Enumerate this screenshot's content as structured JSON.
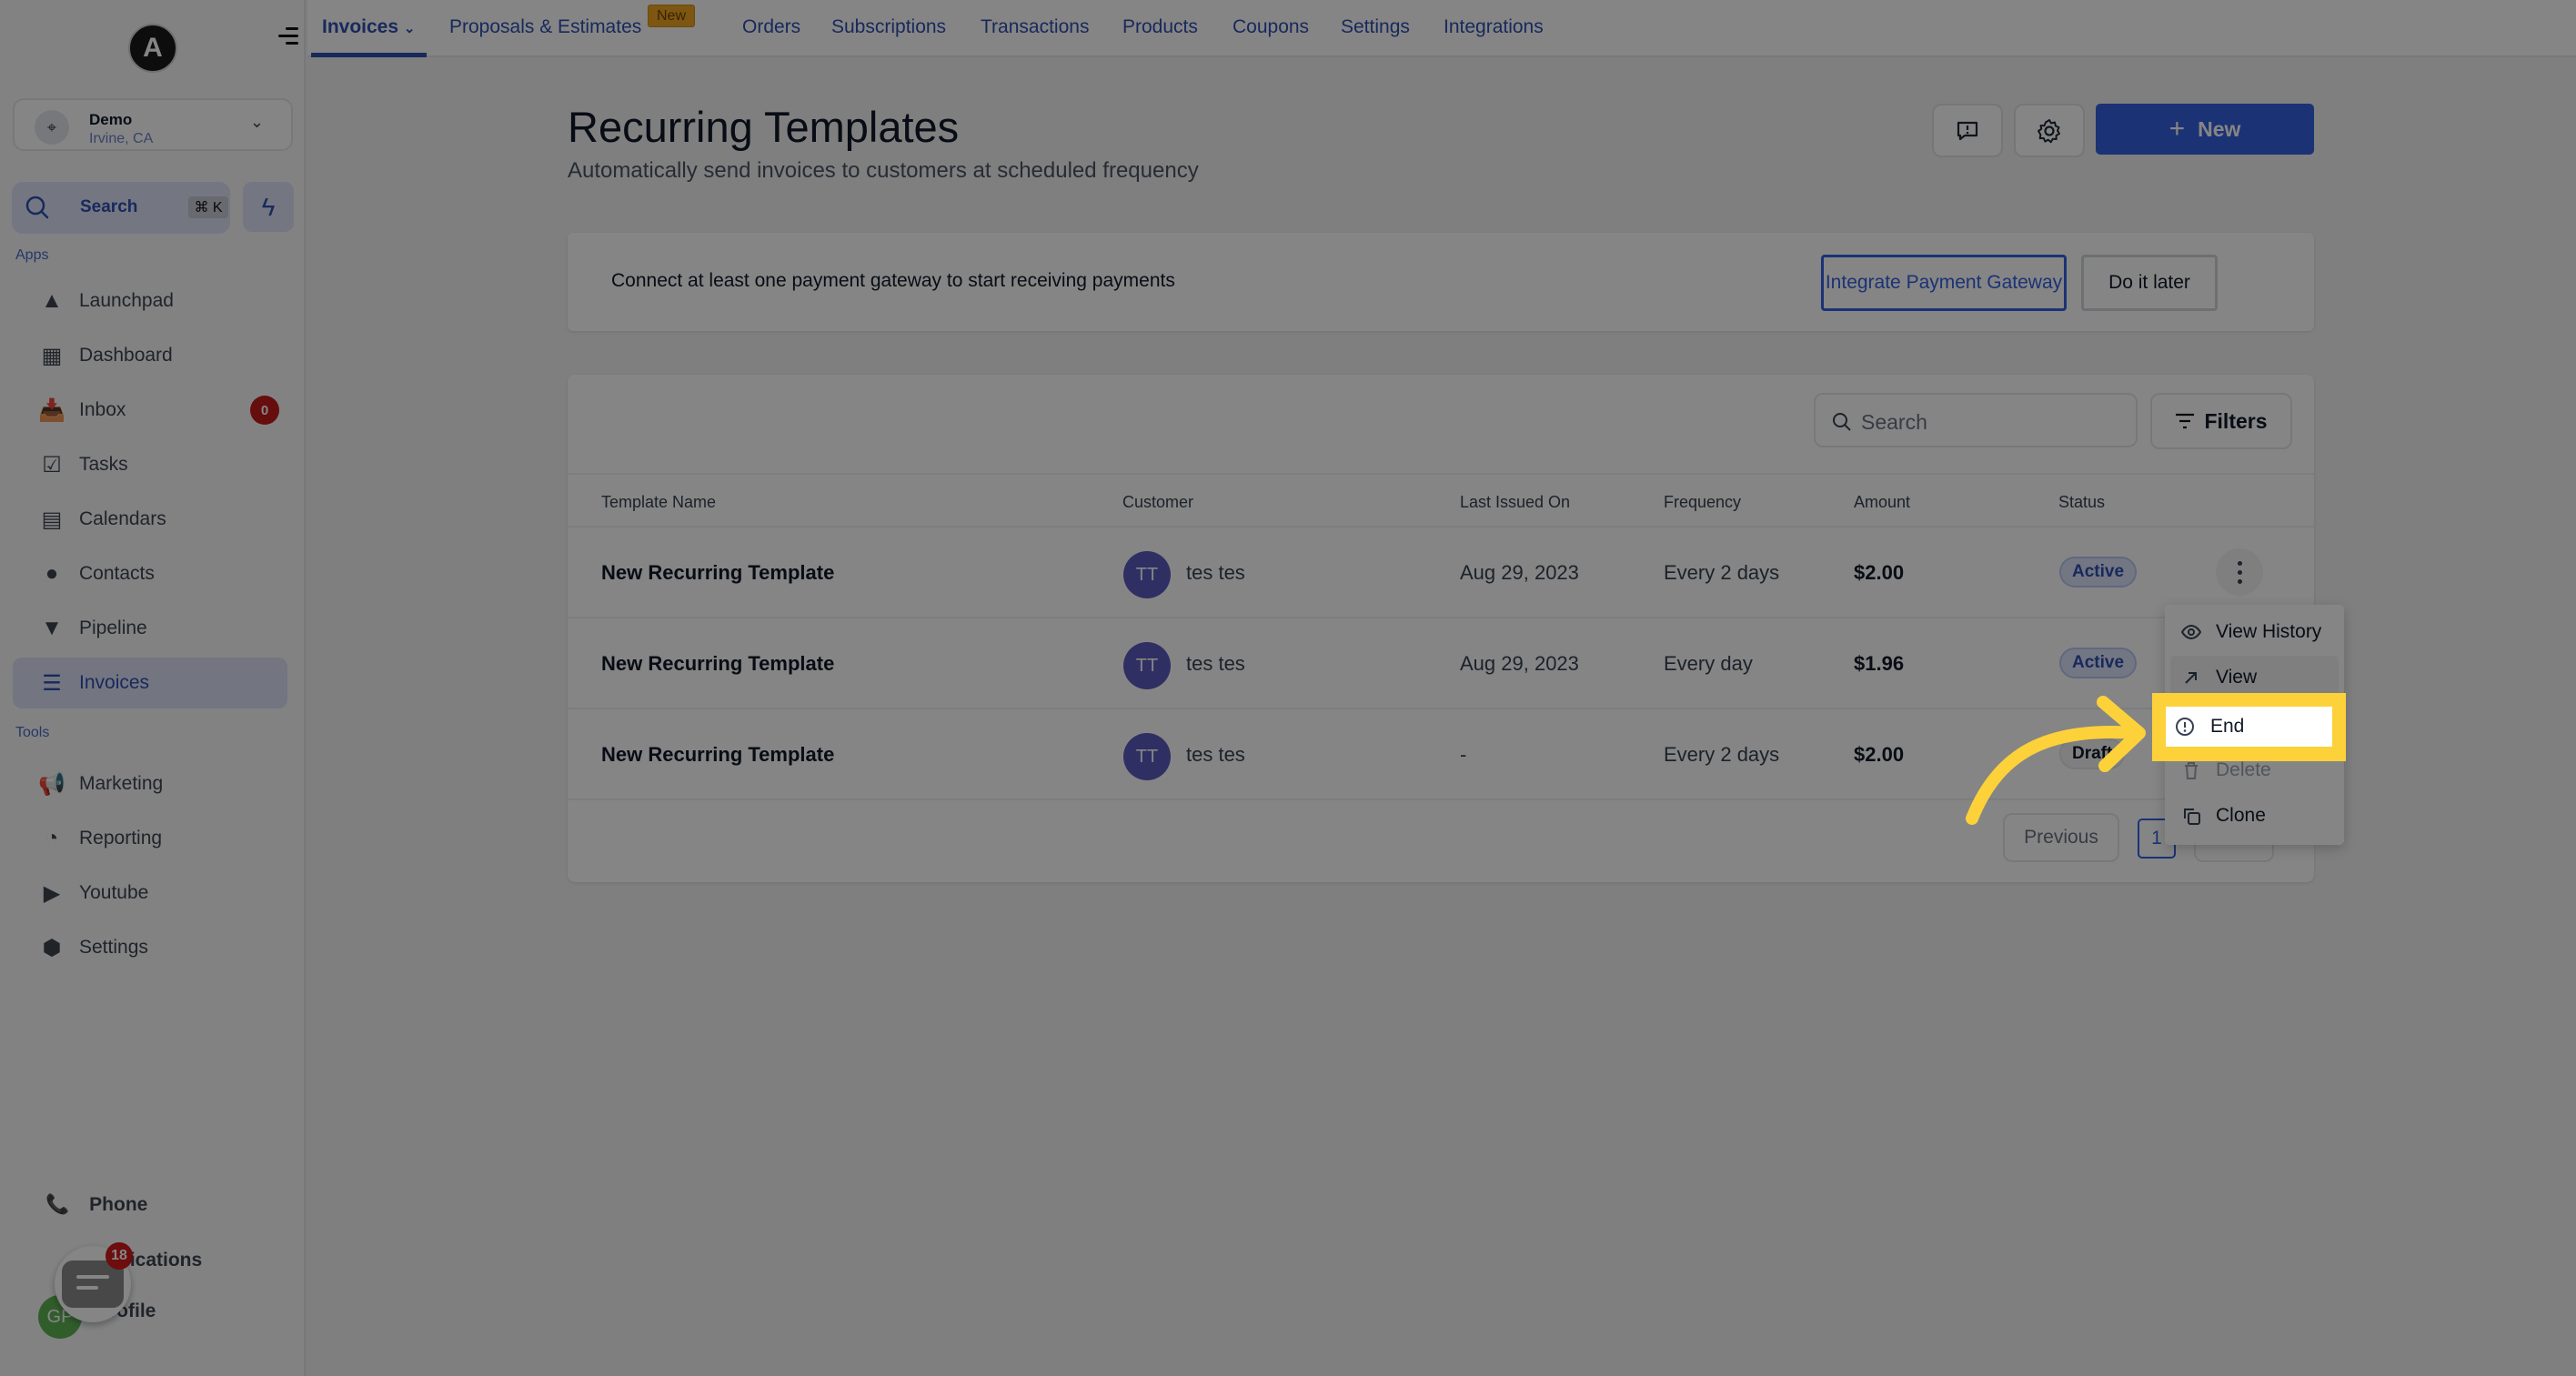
{
  "sidebar": {
    "logo_letter": "A",
    "location": {
      "name": "Demo",
      "city": "Irvine, CA"
    },
    "search": {
      "label": "Search",
      "shortcut": "⌘ K"
    },
    "sections": {
      "apps": "Apps",
      "tools": "Tools"
    },
    "apps": [
      {
        "label": "Launchpad",
        "icon": "rocket-icon"
      },
      {
        "label": "Dashboard",
        "icon": "dashboard-icon"
      },
      {
        "label": "Inbox",
        "icon": "inbox-icon",
        "badge": "0"
      },
      {
        "label": "Tasks",
        "icon": "clipboard-check-icon"
      },
      {
        "label": "Calendars",
        "icon": "calendar-icon"
      },
      {
        "label": "Contacts",
        "icon": "person-icon"
      },
      {
        "label": "Pipeline",
        "icon": "funnel-icon"
      },
      {
        "label": "Invoices",
        "icon": "receipt-icon",
        "active": true
      }
    ],
    "tools": [
      {
        "label": "Marketing",
        "icon": "megaphone-icon"
      },
      {
        "label": "Reporting",
        "icon": "pie-chart-icon"
      },
      {
        "label": "Youtube",
        "icon": "youtube-icon"
      },
      {
        "label": "Settings",
        "icon": "gear-icon"
      }
    ],
    "bottom": {
      "phone": "Phone",
      "notifications": "Notifications",
      "profile": "Profile",
      "avatar_initials": "GP",
      "chat_badge": "18"
    }
  },
  "topnav": {
    "tabs": [
      {
        "label": "Invoices",
        "active": true,
        "has_dropdown": true
      },
      {
        "label": "Proposals & Estimates",
        "badge": "New"
      },
      {
        "label": "Orders"
      },
      {
        "label": "Subscriptions"
      },
      {
        "label": "Transactions"
      },
      {
        "label": "Products"
      },
      {
        "label": "Coupons"
      },
      {
        "label": "Settings"
      },
      {
        "label": "Integrations"
      }
    ]
  },
  "header": {
    "title": "Recurring Templates",
    "subtitle": "Automatically send invoices to customers at scheduled frequency",
    "new_button": "New"
  },
  "banner": {
    "message": "Connect at least one payment gateway to start receiving payments",
    "primary_button": "Integrate Payment Gateway",
    "secondary_button": "Do it later"
  },
  "table": {
    "search_placeholder": "Search",
    "filters_label": "Filters",
    "columns": [
      "Template Name",
      "Customer",
      "Last Issued On",
      "Frequency",
      "Amount",
      "Status"
    ],
    "rows": [
      {
        "name": "New Recurring Template",
        "customer_initials": "TT",
        "customer": "tes tes",
        "last_issued": "Aug 29, 2023",
        "frequency": "Every 2 days",
        "amount": "$2.00",
        "status": "Active"
      },
      {
        "name": "New Recurring Template",
        "customer_initials": "TT",
        "customer": "tes tes",
        "last_issued": "Aug 29, 2023",
        "frequency": "Every day",
        "amount": "$1.96",
        "status": "Active"
      },
      {
        "name": "New Recurring Template",
        "customer_initials": "TT",
        "customer": "tes tes",
        "last_issued": "-",
        "frequency": "Every 2 days",
        "amount": "$2.00",
        "status": "Draft"
      }
    ],
    "pagination": {
      "previous": "Previous",
      "current_page": "1"
    }
  },
  "row_menu": {
    "items": [
      {
        "label": "View History",
        "icon": "eye-icon"
      },
      {
        "label": "View",
        "icon": "arrow-up-right-icon"
      },
      {
        "label": "End",
        "icon": "alert-circle-icon",
        "highlighted": true
      },
      {
        "label": "Delete",
        "icon": "trash-icon",
        "disabled": true
      },
      {
        "label": "Clone",
        "icon": "copy-icon"
      }
    ]
  },
  "colors": {
    "brand_blue": "#3560e0",
    "highlight_yellow": "#fcd13a",
    "danger_badge": "#c41a1a",
    "new_badge": "#f0a623"
  }
}
